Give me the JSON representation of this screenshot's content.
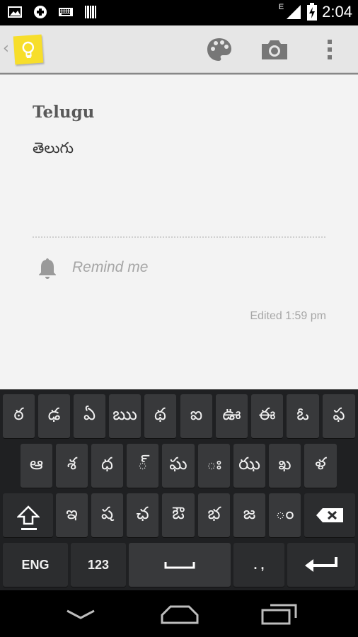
{
  "status_bar": {
    "time": "2:04",
    "network": "E",
    "icons": [
      "image-notification-icon",
      "gamepad-icon",
      "keyboard-icon",
      "barcode-icon"
    ]
  },
  "action_bar": {
    "back_glyph": "‹",
    "app": "Google Keep",
    "actions": [
      "palette-icon",
      "camera-icon",
      "overflow-menu-icon"
    ]
  },
  "note": {
    "title": "Telugu",
    "body": "తెలుగు",
    "remind_label": "Remind me",
    "edited": "Edited 1:59 pm"
  },
  "keyboard": {
    "row1": [
      "ఠ",
      "ఢ",
      "ఏ",
      "ఋ",
      "థ",
      "ఐ",
      "ఊ",
      "ఈ",
      "ఓ",
      "ఫ"
    ],
    "row2": [
      "ఆ",
      "శ",
      "ధ",
      "్",
      "ఘ",
      "ః",
      "ఝ",
      "ఖ",
      "ళ"
    ],
    "row3": [
      "ఇ",
      "ష",
      "ఛ",
      "ఔ",
      "భ",
      "జ",
      "ం"
    ],
    "eng_label": "ENG",
    "num_label": "123",
    "punct_label": ". ,"
  },
  "colors": {
    "action_bar": "#e6e6e6",
    "note_bg": "#f3f3f3",
    "keyboard_bg": "#1f2022",
    "key_bg": "#38393b",
    "keep_yellow": "#f7de2b"
  }
}
